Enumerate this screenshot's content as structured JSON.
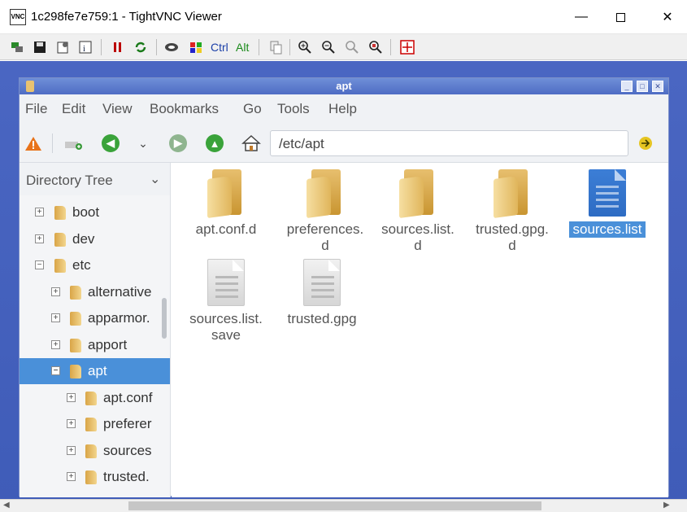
{
  "vnc": {
    "app_icon_text": "VNC",
    "title": "1c298fe7e759:1 - TightVNC Viewer",
    "controls": {
      "minimize": "—",
      "close": "✕"
    },
    "toolbar_text": {
      "ctrl": "Ctrl",
      "alt": "Alt"
    }
  },
  "window": {
    "title": "apt",
    "buttons": [
      "_",
      "□",
      "✕"
    ]
  },
  "menu": [
    "File",
    "Edit",
    "View",
    "Bookmarks",
    "Go",
    "Tools",
    "Help"
  ],
  "toolbar": {
    "path": "/etc/apt"
  },
  "sidebar": {
    "header": "Directory Tree",
    "items": [
      {
        "label": "boot",
        "expander": "+"
      },
      {
        "label": "dev",
        "expander": "+"
      },
      {
        "label": "etc",
        "expander": "−"
      },
      {
        "label": "alternative",
        "expander": "+"
      },
      {
        "label": "apparmor.",
        "expander": "+"
      },
      {
        "label": "apport",
        "expander": "+"
      },
      {
        "label": "apt",
        "expander": "−"
      },
      {
        "label": "apt.conf",
        "expander": "+"
      },
      {
        "label": "preferer",
        "expander": "+"
      },
      {
        "label": "sources",
        "expander": "+"
      },
      {
        "label": "trusted.",
        "expander": "+"
      }
    ]
  },
  "files": [
    {
      "line1": "apt.conf.d",
      "line2": "",
      "type": "folder"
    },
    {
      "line1": "preferences.",
      "line2": "d",
      "type": "folder"
    },
    {
      "line1": "sources.list.",
      "line2": "d",
      "type": "folder"
    },
    {
      "line1": "trusted.gpg.",
      "line2": "d",
      "type": "folder"
    },
    {
      "line1": "sources.list",
      "line2": "",
      "type": "document-blue"
    },
    {
      "line1": "sources.list.",
      "line2": "save",
      "type": "document-gray"
    },
    {
      "line1": "trusted.gpg",
      "line2": "",
      "type": "document-gray"
    }
  ],
  "colors": {
    "selection": "#4a90d9",
    "desktop": "#4a66c2"
  }
}
